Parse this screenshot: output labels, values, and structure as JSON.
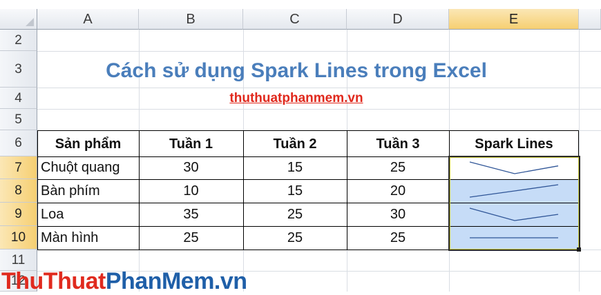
{
  "columns": [
    "A",
    "B",
    "C",
    "D",
    "E"
  ],
  "selected_column": "E",
  "rows": [
    "2",
    "3",
    "4",
    "5",
    "6",
    "7",
    "8",
    "9",
    "10",
    "11",
    "12"
  ],
  "title": "Cách sử dụng Spark Lines trong Excel",
  "link": "thuthuatphanmem.vn",
  "table": {
    "headers": [
      "Sản phẩm",
      "Tuần 1",
      "Tuần 2",
      "Tuần 3",
      "Spark Lines"
    ],
    "rows": [
      {
        "product": "Chuột quang",
        "w1": "30",
        "w2": "15",
        "w3": "25"
      },
      {
        "product": "Bàn phím",
        "w1": "10",
        "w2": "15",
        "w3": "20"
      },
      {
        "product": "Loa",
        "w1": "35",
        "w2": "25",
        "w3": "30"
      },
      {
        "product": "Màn hình",
        "w1": "25",
        "w2": "25",
        "w3": "25"
      }
    ]
  },
  "watermark": {
    "part1": "ThuThuat",
    "part2": "PhanMem.vn"
  },
  "colors": {
    "title": "#4a7ebb",
    "link": "#e0281c",
    "sparkline_selection": "#c6dcf7"
  }
}
